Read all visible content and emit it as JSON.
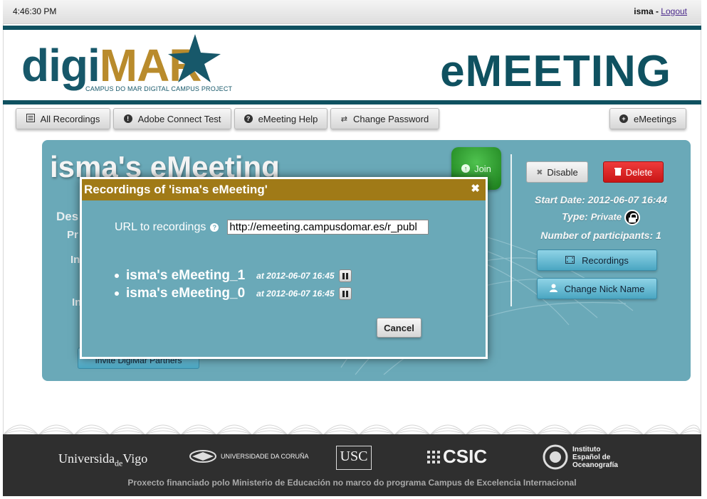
{
  "topbar": {
    "time": "4:46:30 PM",
    "username": "isma",
    "separator": " - ",
    "logout": "Logout"
  },
  "brand": {
    "logo_prefix": "digi",
    "logo_highlight": "MAR",
    "logo_subtitle": "CAMPUS DO MAR DIGITAL CAMPUS PROJECT",
    "app_title": "eMEETING"
  },
  "nav": {
    "all_recordings": "All Recordings",
    "adobe_connect_test": "Adobe Connect Test",
    "emeeting_help": "eMeeting Help",
    "change_password": "Change Password",
    "emeetings": "eMeetings"
  },
  "meeting": {
    "title": "isma's eMeeting",
    "join": "Join",
    "disable": "Disable",
    "delete": "Delete",
    "start_date": "Start Date: 2012-06-07 16:44",
    "type_label": "Type:",
    "type_value": "Private",
    "participants": "Number of participants: 1",
    "recordings_button": "Recordings",
    "change_nick_button": "Change Nick Name",
    "invite_button": "Invite DigiMar Partners",
    "frag_des": "Des",
    "frag_pr": "Pr",
    "frag_in1": "In",
    "frag_in2": "In"
  },
  "modal": {
    "title": "Recordings of 'isma's eMeeting'",
    "close": "✖",
    "url_label": "URL to recordings",
    "url_value": "http://emeeting.campusdomar.es/r_publ",
    "recordings": [
      {
        "name": "isma's eMeeting_1",
        "date": "at 2012-06-07 16:45"
      },
      {
        "name": "isma's eMeeting_0",
        "date": "at 2012-06-07 16:45"
      }
    ],
    "cancel": "Cancel"
  },
  "footer": {
    "uvigo": "Universida",
    "uvigo_de": "de",
    "uvigo_end": "Vigo",
    "udc": "UNIVERSIDADE DA CORUÑA",
    "usc": "USC",
    "csic": "CSIC",
    "ieo_line1": "Instituto",
    "ieo_line2": "Español de",
    "ieo_line3": "Oceanografía",
    "funding": "Proxecto financiado polo Ministerio de Educación no marco do programa Campus de Excelencia Internacional"
  },
  "colors": {
    "band": "#0f5160",
    "panel": "#6aa9b8",
    "modal_header": "#a07a17",
    "gold": "#b98b2c",
    "footer": "#2f2f2f"
  }
}
